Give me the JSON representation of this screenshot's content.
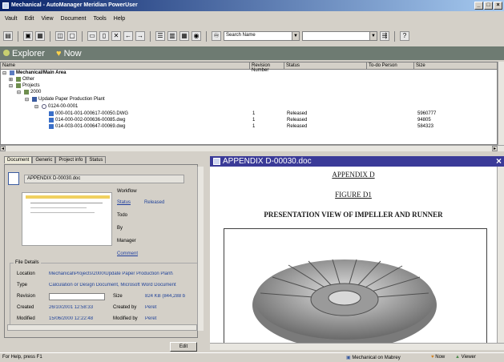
{
  "window": {
    "title": "Mechanical - AutoManager Meridian PowerUser",
    "controls": [
      "_",
      "□",
      "×"
    ]
  },
  "menu": [
    "Vault",
    "Edit",
    "View",
    "Document",
    "Tools",
    "Help"
  ],
  "toolbar": {
    "search_combo": "Search Name",
    "search_value": ""
  },
  "explorer": {
    "title": "Explorer",
    "now_label": "Now"
  },
  "grid": {
    "columns": [
      "Name",
      "Revision Number",
      "Status",
      "To-do Person",
      "Size"
    ],
    "tree": [
      {
        "label": "Mechanical/Main Area",
        "level": 0,
        "icon": "vault-icon",
        "bold": true
      },
      {
        "label": "Other",
        "level": 1,
        "icon": "folder-icon"
      },
      {
        "label": "Projects",
        "level": 1,
        "icon": "folder-icon"
      },
      {
        "label": "2000",
        "level": 2,
        "icon": "folder-icon"
      },
      {
        "label": "Update Paper Production Plant",
        "level": 3,
        "icon": "project-icon"
      },
      {
        "label": "0124-00-0001",
        "level": 4,
        "icon": "gear-icon"
      },
      {
        "label": "000-001-001-000617-00050.DWG",
        "level": 5,
        "icon": "drawing-icon",
        "rev": "1",
        "status": "Released",
        "size": "5960777"
      },
      {
        "label": "014-000-002-000636-00085.dwg",
        "level": 5,
        "icon": "drawing-icon",
        "rev": "1",
        "status": "Released",
        "size": "94805"
      },
      {
        "label": "014-003-001-000647-00069.dwg",
        "level": 5,
        "icon": "drawing-icon",
        "rev": "1",
        "status": "Released",
        "size": "584323"
      }
    ]
  },
  "properties": {
    "tabs": [
      "Document",
      "Generic",
      "Project info",
      "Status"
    ],
    "doc_name": "APPENDIX D-00030.doc",
    "workflow": {
      "heading": "Workflow",
      "rows": [
        {
          "label": "Status",
          "value": "Released",
          "link": true
        },
        {
          "label": "Todo",
          "value": ""
        },
        {
          "label": "By",
          "value": ""
        },
        {
          "label": "Manager",
          "value": ""
        },
        {
          "label": "Comment",
          "value": "",
          "link": true
        }
      ]
    },
    "file_details": {
      "legend": "File Details",
      "rows": [
        {
          "label": "Location",
          "value": "Mechanical\\Projects\\2000\\Update Paper Production Plant\\"
        },
        {
          "label": "Type",
          "value": "Calculation or Design Document, Microsoft Word Document"
        },
        {
          "label": "Revision",
          "value": "",
          "label2": "Size",
          "value2": "824 KB (844,288 b"
        },
        {
          "label": "Created",
          "value": "26/10/2001 12:58:33",
          "label2": "Created by",
          "value2": "Peret"
        },
        {
          "label": "Modified",
          "value": "15/06/2000 12:22:48",
          "label2": "Modified by",
          "value2": "Peret"
        }
      ]
    },
    "edit_button": "Edit"
  },
  "preview": {
    "title": "APPENDIX D-00030.doc",
    "heading1": "APPENDIX D",
    "heading2": "FIGURE D1",
    "heading3": "PRESENTATION VIEW OF IMPELLER AND RUNNER"
  },
  "status": {
    "help": "For Help, press F1",
    "vault": "Mechanical on Mabrey",
    "now": "Now",
    "viewer": "Viewer"
  }
}
